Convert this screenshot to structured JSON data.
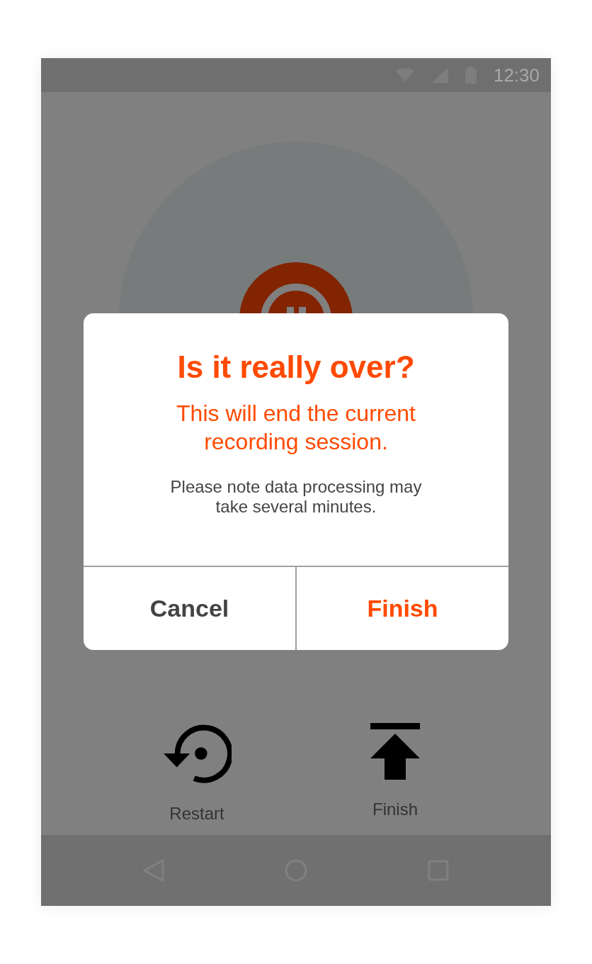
{
  "status_bar": {
    "time": "12:30"
  },
  "dialog": {
    "title": "Is it really over?",
    "message": "This will end the current recording session.",
    "note": "Please note data processing may take several minutes.",
    "buttons": [
      {
        "label": "Cancel",
        "kind": "cancel"
      },
      {
        "label": "Finish",
        "kind": "confirm"
      }
    ]
  },
  "actions": [
    {
      "label": "Restart",
      "kind": "restart"
    },
    {
      "label": "Finish",
      "kind": "finish"
    }
  ]
}
